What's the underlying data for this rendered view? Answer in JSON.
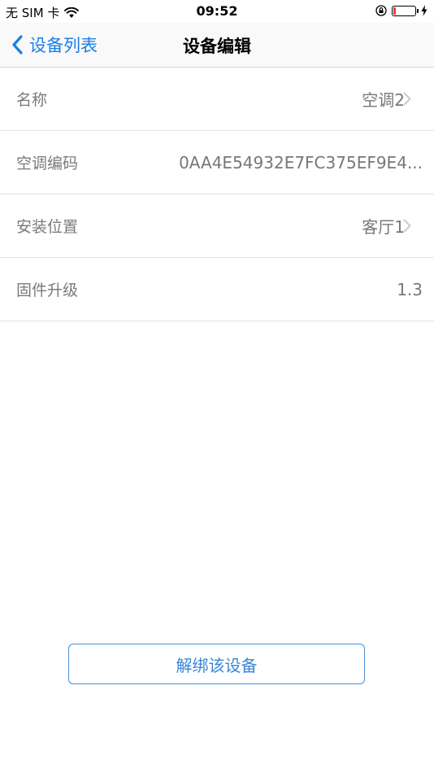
{
  "status_bar": {
    "carrier": "无 SIM 卡",
    "time": "09:52"
  },
  "nav": {
    "back_label": "设备列表",
    "title": "设备编辑"
  },
  "rows": [
    {
      "label": "名称",
      "value": "空调2",
      "has_chevron": true
    },
    {
      "label": "空调编码",
      "value": "0AA4E54932E7FC375EF9E4...",
      "has_chevron": false
    },
    {
      "label": "安装位置",
      "value": "客厅1",
      "has_chevron": true
    },
    {
      "label": "固件升级",
      "value": "1.3",
      "has_chevron": false
    }
  ],
  "actions": {
    "unbind_label": "解绑该设备"
  },
  "colors": {
    "accent": "#1a7ee6",
    "battery_low": "#ff3b30"
  }
}
